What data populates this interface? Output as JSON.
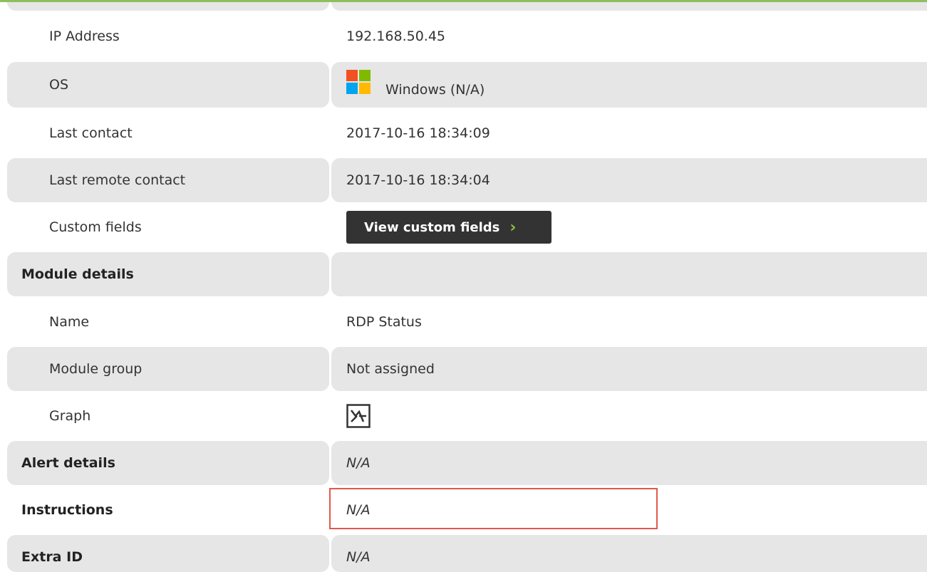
{
  "details": {
    "ip_label": "IP Address",
    "ip_value": "192.168.50.45",
    "os_label": "OS",
    "os_value": "Windows (N/A)",
    "os_icon": "windows-logo-icon",
    "os_logo_colors": [
      "#f25022",
      "#7fba00",
      "#00a4ef",
      "#ffb900"
    ],
    "last_contact_label": "Last contact",
    "last_contact_value": "2017-10-16 18:34:09",
    "last_remote_label": "Last remote contact",
    "last_remote_value": "2017-10-16 18:34:04",
    "custom_fields_label": "Custom fields",
    "custom_fields_button": "View custom fields",
    "custom_fields_button_icon": "chevron-right-icon"
  },
  "module": {
    "section_title": "Module details",
    "name_label": "Name",
    "name_value": "RDP Status",
    "group_label": "Module group",
    "group_value": "Not assigned",
    "graph_label": "Graph",
    "graph_icon": "graph-icon"
  },
  "alert": {
    "label": "Alert details",
    "value": "N/A"
  },
  "instructions": {
    "label": "Instructions",
    "value": "N/A"
  },
  "extra_id": {
    "label": "Extra ID",
    "value": "N/A"
  },
  "colors": {
    "accent_line": "#8ebf5e",
    "row_shade": "#e6e6e6",
    "button_bg": "#333333",
    "chevron": "#86c440",
    "highlight_box": "#e2574c"
  }
}
